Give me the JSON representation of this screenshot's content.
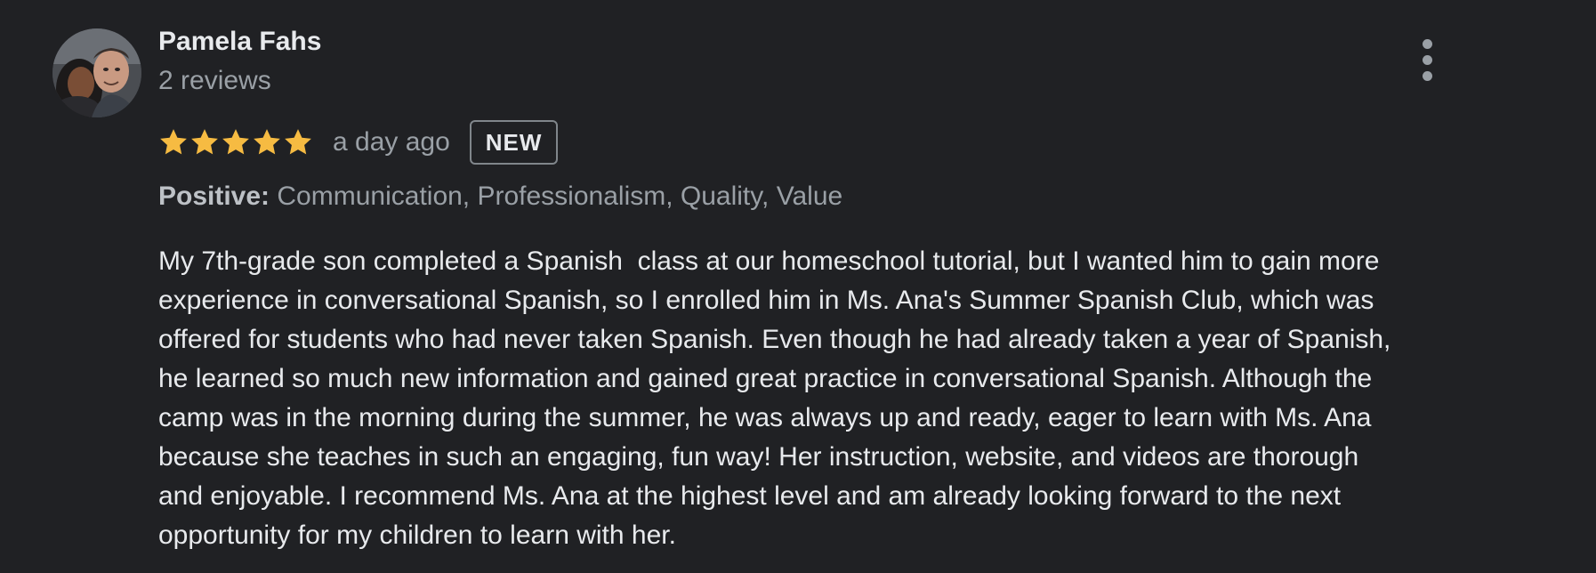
{
  "review": {
    "author": {
      "name": "Pamela Fahs",
      "meta": "2 reviews"
    },
    "rating": {
      "stars": 5,
      "max": 5,
      "star_color": "#f6bb42"
    },
    "date": "a day ago",
    "badge": "NEW",
    "attributes": {
      "label": "Positive:",
      "values": "Communication, Professionalism, Quality, Value"
    },
    "text_lines": [
      "My 7th-grade son completed a Spanish  class at our homeschool tutorial, but I wanted him to gain more",
      "experience in conversational Spanish, so I enrolled him in Ms. Ana's Summer Spanish Club, which was",
      "offered for students who had never taken Spanish. Even though he had already taken a year of Spanish,",
      "he learned so much new information and gained great practice in conversational Spanish. Although the",
      "camp was in the morning during the summer, he was always up and ready, eager to learn with Ms. Ana",
      "because she teaches in such an engaging, fun way! Her instruction, website, and videos are thorough",
      "and enjoyable. I recommend Ms. Ana at the highest level and am already looking forward to the next",
      "opportunity for my children to learn with her."
    ],
    "icons": {
      "avatar": "profile-photo",
      "more": "more-vert-icon",
      "star": "star-icon"
    }
  }
}
